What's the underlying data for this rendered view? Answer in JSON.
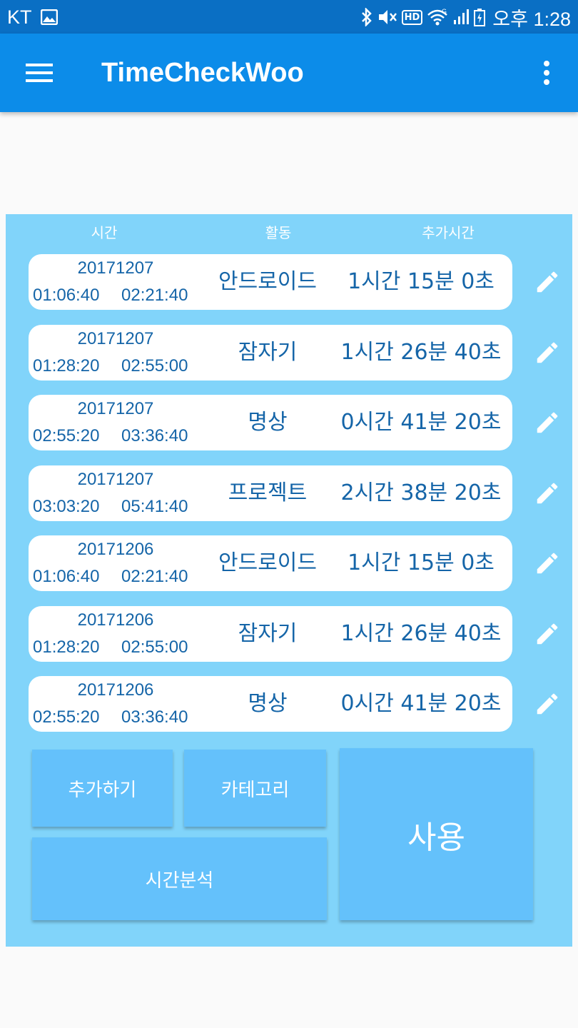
{
  "status_bar": {
    "carrier": "KT",
    "time": "오후 1:28",
    "hd_label": "HD",
    "network_label": "G",
    "icons": [
      "image-icon",
      "bluetooth-icon",
      "mute-icon",
      "hd-icon",
      "wifi-icon",
      "signal-icon",
      "battery-icon"
    ]
  },
  "app_bar": {
    "title": "TimeCheckWoo",
    "color": "#0c8ce9"
  },
  "headers": {
    "time": "시간",
    "activity": "활동",
    "extra_time": "추가시간"
  },
  "records": [
    {
      "date": "20171207",
      "start": "01:06:40",
      "end": "02:21:40",
      "activity": "안드로이드",
      "duration": "1시간 15분 0초"
    },
    {
      "date": "20171207",
      "start": "01:28:20",
      "end": "02:55:00",
      "activity": "잠자기",
      "duration": "1시간 26분 40초"
    },
    {
      "date": "20171207",
      "start": "02:55:20",
      "end": "03:36:40",
      "activity": "명상",
      "duration": "0시간 41분 20초"
    },
    {
      "date": "20171207",
      "start": "03:03:20",
      "end": "05:41:40",
      "activity": "프로젝트",
      "duration": "2시간 38분 20초"
    },
    {
      "date": "20171206",
      "start": "01:06:40",
      "end": "02:21:40",
      "activity": "안드로이드",
      "duration": "1시간 15분 0초"
    },
    {
      "date": "20171206",
      "start": "01:28:20",
      "end": "02:55:00",
      "activity": "잠자기",
      "duration": "1시간 26분 40초"
    },
    {
      "date": "20171206",
      "start": "02:55:20",
      "end": "03:36:40",
      "activity": "명상",
      "duration": "0시간 41분 20초"
    }
  ],
  "buttons": {
    "add": "추가하기",
    "category": "카테고리",
    "analysis": "시간분석",
    "use": "사용"
  },
  "colors": {
    "panel": "#81d4fa",
    "button": "#64c1fb",
    "text": "#1565a8"
  }
}
